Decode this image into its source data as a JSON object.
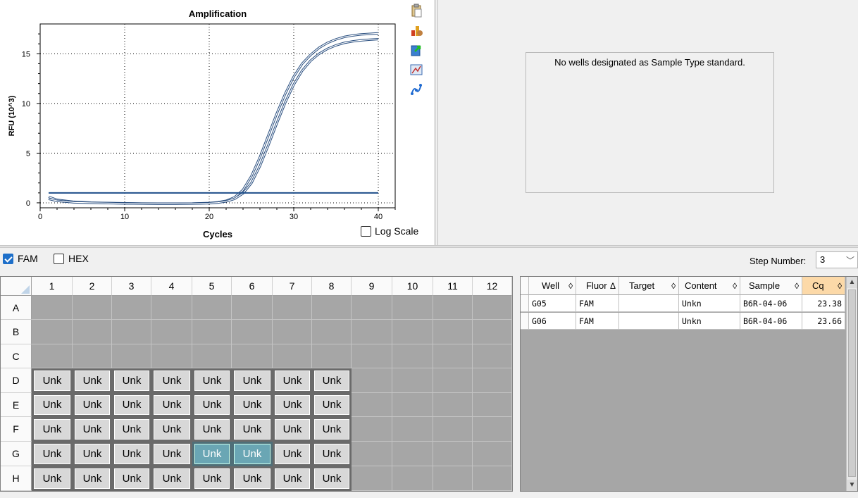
{
  "chart": {
    "title": "Amplification",
    "xlabel": "Cycles",
    "ylabel": "RFU (10^3)",
    "log_scale_label": "Log Scale",
    "log_scale_checked": false,
    "toolbar_icons": [
      "clipboard-icon",
      "chart-style-icon",
      "export-icon",
      "image-icon",
      "curve-icon"
    ]
  },
  "chart_data": {
    "type": "line",
    "title": "Amplification",
    "xlabel": "Cycles",
    "ylabel": "RFU (10^3)",
    "xlim": [
      0,
      42
    ],
    "ylim": [
      -0.5,
      18
    ],
    "xticks": [
      0,
      10,
      20,
      30,
      40
    ],
    "yticks": [
      0,
      5,
      10,
      15
    ],
    "grid": true,
    "threshold": 1.0,
    "series": [
      {
        "x": [
          1,
          2,
          4,
          6,
          8,
          10,
          12,
          14,
          16,
          18,
          20,
          21,
          22,
          23,
          24,
          25,
          26,
          27,
          28,
          29,
          30,
          31,
          32,
          33,
          34,
          35,
          36,
          37,
          38,
          39,
          40
        ],
        "y": [
          0.6,
          0.3,
          0.1,
          0.02,
          -0.02,
          -0.05,
          -0.07,
          -0.08,
          -0.08,
          -0.07,
          -0.02,
          0.05,
          0.2,
          0.55,
          1.3,
          2.7,
          4.6,
          6.8,
          9.0,
          11.0,
          12.7,
          14.0,
          14.9,
          15.6,
          16.1,
          16.45,
          16.7,
          16.85,
          16.95,
          17.0,
          17.05
        ]
      },
      {
        "x": [
          1,
          2,
          4,
          6,
          8,
          10,
          12,
          14,
          16,
          18,
          20,
          21,
          22,
          23,
          24,
          25,
          26,
          27,
          28,
          29,
          30,
          31,
          32,
          33,
          34,
          35,
          36,
          37,
          38,
          39,
          40
        ],
        "y": [
          0.4,
          0.2,
          0.05,
          0.0,
          -0.03,
          -0.06,
          -0.08,
          -0.09,
          -0.09,
          -0.08,
          -0.04,
          0.02,
          0.14,
          0.4,
          0.95,
          2.0,
          3.7,
          5.8,
          8.0,
          10.1,
          11.9,
          13.3,
          14.3,
          15.0,
          15.5,
          15.85,
          16.1,
          16.25,
          16.35,
          16.42,
          16.47
        ]
      }
    ]
  },
  "std_curve": {
    "message": "No wells designated as Sample Type standard."
  },
  "fluors": [
    {
      "label": "FAM",
      "checked": true
    },
    {
      "label": "HEX",
      "checked": false
    }
  ],
  "step": {
    "label": "Step Number:",
    "value": "3"
  },
  "plate": {
    "columns": [
      "1",
      "2",
      "3",
      "4",
      "5",
      "6",
      "7",
      "8",
      "9",
      "10",
      "11",
      "12"
    ],
    "rows": [
      "A",
      "B",
      "C",
      "D",
      "E",
      "F",
      "G",
      "H"
    ],
    "well_label": "Unk",
    "filled_rows": [
      "D",
      "E",
      "F",
      "G",
      "H"
    ],
    "filled_cols": 8,
    "selected": [
      "G5",
      "G6"
    ]
  },
  "table": {
    "headers": [
      {
        "label": "Well",
        "sort": "◊"
      },
      {
        "label": "Fluor",
        "sort": "Δ"
      },
      {
        "label": "Target",
        "sort": "◊"
      },
      {
        "label": "Content",
        "sort": "◊"
      },
      {
        "label": "Sample",
        "sort": "◊"
      },
      {
        "label": "Cq",
        "sort": "◊"
      }
    ],
    "rows": [
      [
        "G05",
        "FAM",
        "",
        "Unkn",
        "B6R-04-06",
        "23.38"
      ],
      [
        "G06",
        "FAM",
        "",
        "Unkn",
        "B6R-04-06",
        "23.66"
      ]
    ]
  }
}
